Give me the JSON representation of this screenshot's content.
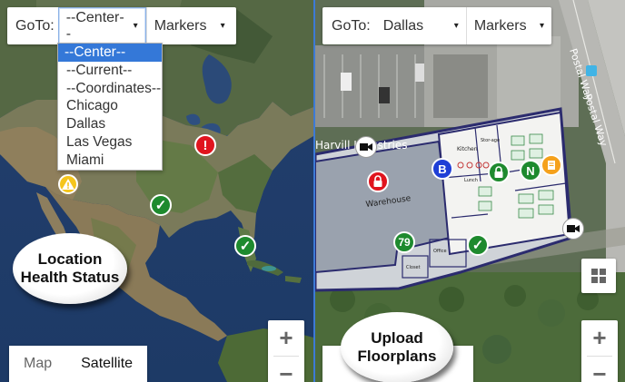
{
  "left": {
    "goto_label": "GoTo:",
    "location_select": {
      "value": "--Center--",
      "caret": "▾"
    },
    "markers_select": {
      "value": "Markers",
      "caret": "▾"
    },
    "dropdown_options": [
      "--Center--",
      "--Current--",
      "--Coordinates--",
      "Chicago",
      "Dallas",
      "Las Vegas",
      "Miami"
    ],
    "dropdown_selected_index": 0,
    "callout": {
      "line1": "Location",
      "line2": "Health Status"
    },
    "map_type": {
      "map": "Map",
      "satellite": "Satellite",
      "active": "Satellite"
    },
    "zoom": {
      "in": "+",
      "out": "−"
    },
    "markers": [
      {
        "kind": "alert",
        "color": "#e0141e",
        "glyph": "!"
      },
      {
        "kind": "warning",
        "color": "#f5c51c",
        "glyph": "!"
      },
      {
        "kind": "ok",
        "color": "#1e8a2e",
        "glyph": "✓"
      },
      {
        "kind": "ok",
        "color": "#1e8a2e",
        "glyph": "✓"
      }
    ]
  },
  "right": {
    "goto_label": "GoTo:",
    "location_select": {
      "value": "Dallas",
      "caret": "▾"
    },
    "markers_select": {
      "value": "Markers",
      "caret": "▾"
    },
    "street_label": "Postal Way",
    "building_label": "Harvill Industries",
    "warehouse_label": "Warehouse",
    "room_labels": {
      "kitchen": "Kitchen",
      "storage": "Stor-age",
      "lunch": "Lunch",
      "office": "Office",
      "closet": "Closet"
    },
    "callout": {
      "line1": "Upload",
      "line2": "Floorplans"
    },
    "zoom": {
      "in": "+",
      "out": "−"
    },
    "markers": [
      {
        "kind": "lock-alert",
        "color": "#e0141e"
      },
      {
        "kind": "badge",
        "color": "#1f3fd6",
        "text": "B"
      },
      {
        "kind": "lock-ok",
        "color": "#1e8a2e"
      },
      {
        "kind": "badge",
        "color": "#1e8a2e",
        "text": "N"
      },
      {
        "kind": "note",
        "color": "#f5a11c"
      },
      {
        "kind": "count",
        "color": "#1e8a2e",
        "text": "79"
      },
      {
        "kind": "ok",
        "color": "#1e8a2e",
        "glyph": "✓"
      },
      {
        "kind": "camera",
        "color": "#ffffff"
      },
      {
        "kind": "camera",
        "color": "#ffffff"
      }
    ]
  }
}
